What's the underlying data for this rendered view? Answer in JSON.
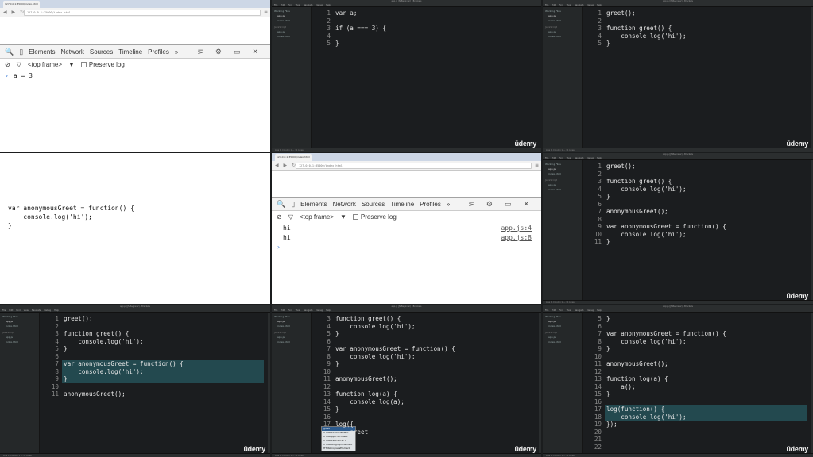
{
  "browser": {
    "tab_title": "127.0.0.1:35000/index.html",
    "url": "127.0.0.1:35000/index.html",
    "devtools_tabs": [
      "Elements",
      "Network",
      "Sources",
      "Timeline",
      "Profiles",
      "»"
    ],
    "frame_label": "<top frame>",
    "preserve_log": "Preserve log"
  },
  "t1": {
    "console_line": "a = 3",
    "page_code": [
      "var anonymousGreet = function() {",
      "    console.log('hi');",
      "}"
    ]
  },
  "t5": {
    "console": [
      {
        "text": "hi",
        "src": "app.js:4"
      },
      {
        "text": "hi",
        "src": "app.js:8"
      }
    ]
  },
  "editor": {
    "title": "app.js (JS-Beginner) - Brackets",
    "menu": [
      "File",
      "Edit",
      "Find",
      "View",
      "Navigate",
      "Debug",
      "Help"
    ],
    "working_files": "Working Files",
    "project": "JavaScript",
    "files": [
      "app.js",
      "index.html"
    ],
    "status": "Line 1, Column 1 — 11 Lines",
    "watermark": "ūdemy"
  },
  "t2": {
    "lines": [
      "var a;",
      "",
      "if (a === 3) {",
      "",
      "}"
    ]
  },
  "t3": {
    "lines": [
      "greet();",
      "",
      "function greet() {",
      "    console.log('hi');",
      "}"
    ]
  },
  "t6": {
    "lines": [
      "greet();",
      "",
      "function greet() {",
      "    console.log('hi');",
      "}",
      "",
      "anonymousGreet();",
      "",
      "var anonymousGreet = function() {",
      "    console.log('hi');",
      "}"
    ]
  },
  "t7": {
    "lines": [
      "greet();",
      "",
      "function greet() {",
      "    console.log('hi');",
      "}",
      "",
      "var anonymousGreet = function() {",
      "    console.log('hi');",
      "}",
      "",
      "anonymousGreet();"
    ],
    "highlight": [
      7,
      8,
      9
    ]
  },
  "t8": {
    "start": 3,
    "lines": [
      "function greet() {",
      "    console.log('hi');",
      "}",
      "",
      "var anonymousGreet = function() {",
      "    console.log('hi');",
      "}",
      "",
      "anonymousGreet();",
      "",
      "function log(a) {",
      "    console.log(a);",
      "}",
      "",
      "log({",
      "    greet",
      "});",
      ""
    ],
    "autocomplete": [
      "greet",
      "HTMLAnchorElement",
      "HTMLAppletElement",
      "HTMLAreaElement",
      "HTMLParagraphElement",
      "HTMLProgressElement"
    ]
  },
  "t9": {
    "start": 5,
    "lines": [
      "}",
      "",
      "var anonymousGreet = function() {",
      "    console.log('hi');",
      "}",
      "",
      "anonymousGreet();",
      "",
      "function log(a) {",
      "    a();",
      "}",
      "",
      "log(function() {",
      "    console.log('hi');",
      "});",
      "",
      "",
      ""
    ],
    "highlight": [
      17,
      18
    ]
  }
}
